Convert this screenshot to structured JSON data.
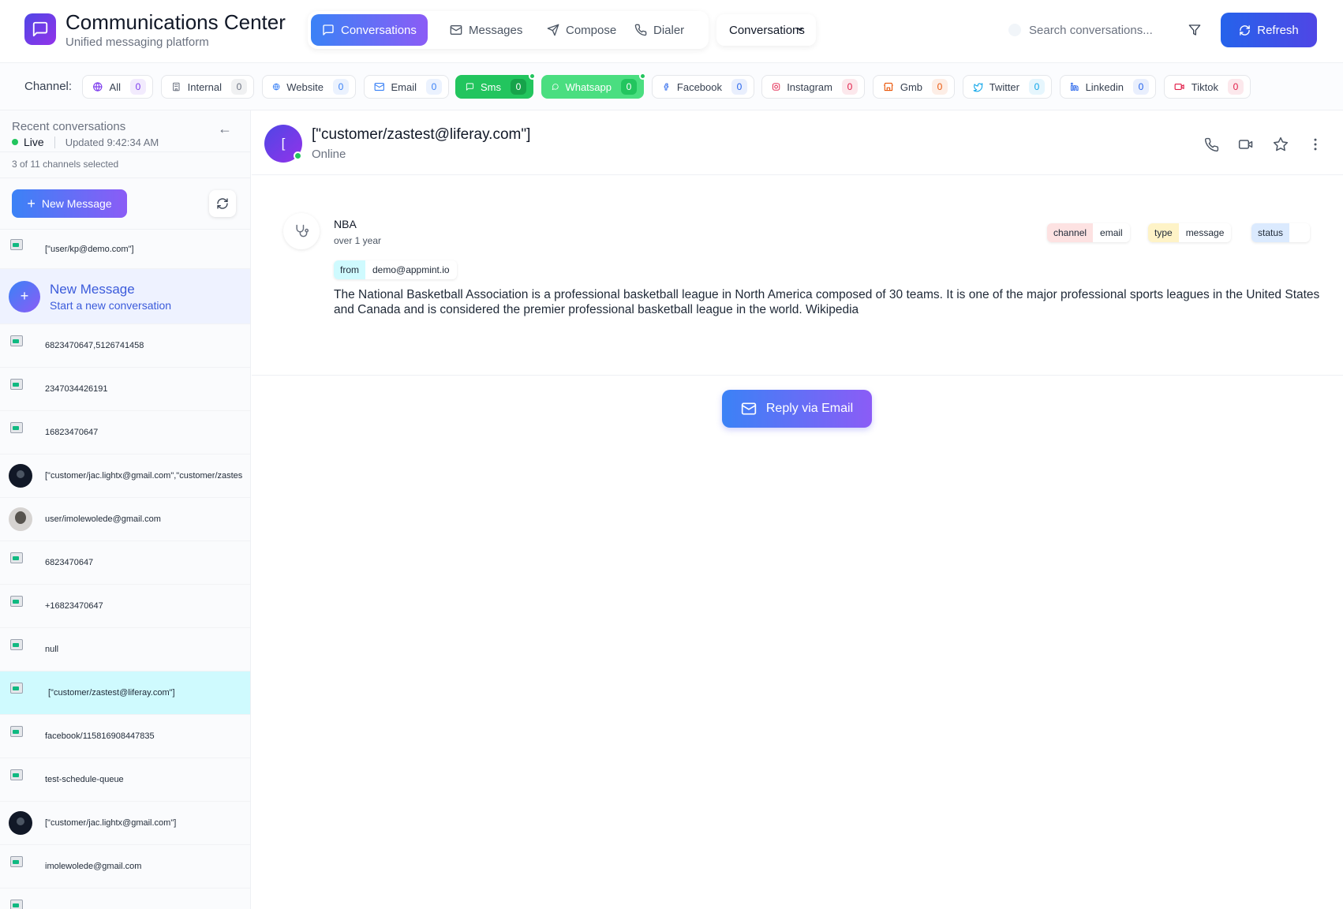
{
  "app": {
    "title": "Communications Center",
    "subtitle": "Unified messaging platform",
    "accent": "#4f46e5"
  },
  "nav": {
    "tabs": [
      {
        "label": "Conversations",
        "icon": "message-square-icon",
        "active": true
      },
      {
        "label": "Messages",
        "icon": "mail-icon",
        "active": false
      },
      {
        "label": "Compose",
        "icon": "send-icon",
        "active": false
      },
      {
        "label": "Dialer",
        "icon": "phone-icon",
        "active": false
      }
    ],
    "view_select": "Conversations"
  },
  "search": {
    "placeholder": "Search conversations..."
  },
  "refresh_label": "Refresh",
  "channel_bar": {
    "label": "Channel:",
    "chips": [
      {
        "label": "All",
        "count": "0",
        "icon": "globe-icon",
        "color": "#7c3aed",
        "selected": false
      },
      {
        "label": "Internal",
        "count": "0",
        "icon": "building-icon",
        "color": "#6b7280",
        "selected": false
      },
      {
        "label": "Website",
        "count": "0",
        "icon": "globe-icon",
        "color": "#3b82f6",
        "selected": false
      },
      {
        "label": "Email",
        "count": "0",
        "icon": "mail-icon",
        "color": "#3b82f6",
        "selected": false
      },
      {
        "label": "Sms",
        "count": "0",
        "icon": "message-square-icon",
        "color": "#22c55e",
        "selected": true
      },
      {
        "label": "Whatsapp",
        "count": "0",
        "icon": "whatsapp-icon",
        "color": "#22c55e",
        "selected": true
      },
      {
        "label": "Facebook",
        "count": "0",
        "icon": "facebook-icon",
        "color": "#2563eb",
        "selected": false
      },
      {
        "label": "Instagram",
        "count": "0",
        "icon": "instagram-icon",
        "color": "#e11d48",
        "selected": false
      },
      {
        "label": "Gmb",
        "count": "0",
        "icon": "store-icon",
        "color": "#ea580c",
        "selected": false
      },
      {
        "label": "Twitter",
        "count": "0",
        "icon": "twitter-icon",
        "color": "#0ea5e9",
        "selected": false
      },
      {
        "label": "Linkedin",
        "count": "0",
        "icon": "linkedin-icon",
        "color": "#2563eb",
        "selected": false
      },
      {
        "label": "Tiktok",
        "count": "0",
        "icon": "video-icon",
        "color": "#e11d48",
        "selected": false
      }
    ]
  },
  "sidebar": {
    "title": "Recent conversations",
    "live": "Live",
    "updated": "Updated 9:42:34 AM",
    "selection_count": "3 of 11 channels selected",
    "new_message_label": "New Message",
    "new_conversation": {
      "title": "New Message",
      "subtitle": "Start a new conversation"
    },
    "top_item": "[\"user/kp@demo.com\"]",
    "conversations": [
      {
        "name": "6823470647,5126741458",
        "avatar": "broken",
        "selected": false
      },
      {
        "name": "2347034426191",
        "avatar": "broken",
        "selected": false
      },
      {
        "name": "16823470647",
        "avatar": "broken",
        "selected": false
      },
      {
        "name": "[\"customer/jac.lightx@gmail.com\",\"customer/zastes",
        "avatar": "dark",
        "selected": false
      },
      {
        "name": "user/imolewolede@gmail.com",
        "avatar": "photo",
        "selected": false
      },
      {
        "name": "6823470647",
        "avatar": "broken",
        "selected": false
      },
      {
        "name": "+16823470647",
        "avatar": "broken",
        "selected": false
      },
      {
        "name": "null",
        "avatar": "broken",
        "selected": false
      },
      {
        "name": "[\"customer/zastest@liferay.com\"]",
        "avatar": "broken",
        "selected": true
      },
      {
        "name": "facebook/115816908447835",
        "avatar": "broken",
        "selected": false
      },
      {
        "name": "test-schedule-queue",
        "avatar": "broken",
        "selected": false
      },
      {
        "name": "[\"customer/jac.lightx@gmail.com\"]",
        "avatar": "dark",
        "selected": false
      },
      {
        "name": "imolewolede@gmail.com",
        "avatar": "broken",
        "selected": false
      },
      {
        "name": "",
        "avatar": "broken",
        "selected": false
      }
    ]
  },
  "chat": {
    "avatar_letter": "[",
    "name": "[\"customer/zastest@liferay.com\"]",
    "status": "Online",
    "message": {
      "sender": "NBA",
      "time": "over 1 year",
      "from_key": "from",
      "from_value": "demo@appmint.io",
      "tags": [
        {
          "key": "channel",
          "value": "email",
          "key_bg": "#fde2e2"
        },
        {
          "key": "type",
          "value": "message",
          "key_bg": "#fef3c7"
        },
        {
          "key": "status",
          "value": "",
          "key_bg": "#dbeafe"
        }
      ],
      "body": "The National Basketball Association is a professional basketball league in North America composed of 30 teams. It is one of the major professional sports leagues in the United States and Canada and is considered the premier professional basketball league in the world. Wikipedia"
    },
    "reply_label": "Reply via Email"
  }
}
